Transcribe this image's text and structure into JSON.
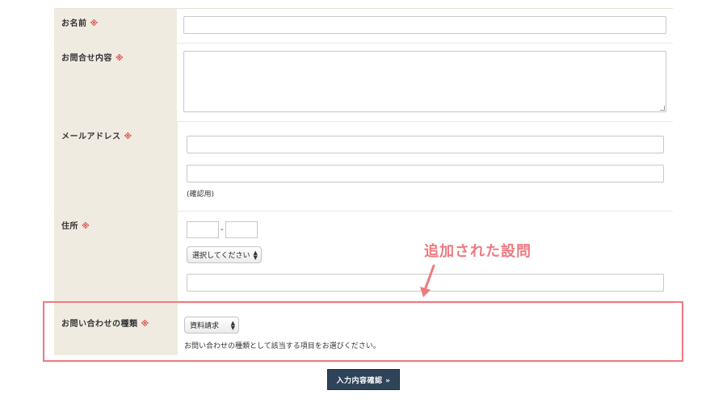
{
  "required_mark": "※",
  "fields": {
    "name": {
      "label": "お名前"
    },
    "inquiry": {
      "label": "お問合せ内容"
    },
    "email": {
      "label": "メールアドレス",
      "confirm_note": "(確認用)"
    },
    "address": {
      "label": "住所",
      "zip_separator": "-",
      "prefecture_select": "選択してください"
    },
    "inquiry_type": {
      "label": "お問い合わせの種類",
      "select_value": "資料請求",
      "help_text": "お問い合わせの種類として該当する項目をお選びください。"
    }
  },
  "annotation": {
    "text": "追加された設問",
    "color": "#ec7b80"
  },
  "submit": {
    "label": "入力内容確認 »"
  },
  "colors": {
    "label_bg": "#f0ebe0",
    "required": "#d9534f",
    "button_bg": "#2f4359"
  }
}
